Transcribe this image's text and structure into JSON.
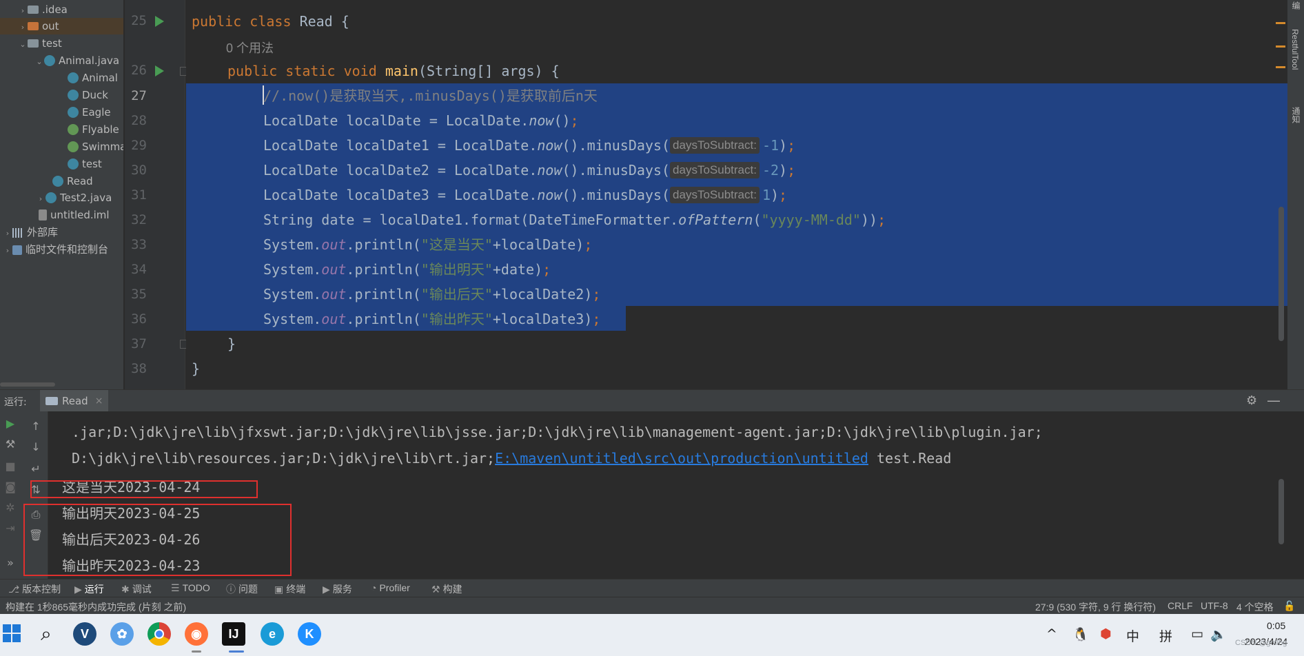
{
  "project_tree": [
    {
      "label": ".idea",
      "icon": "folder-icon",
      "arrow": "›"
    },
    {
      "label": "out",
      "icon": "folder-orange-icon",
      "arrow": "›"
    },
    {
      "label": "test",
      "icon": "folder-icon",
      "arrow": "⌄"
    },
    {
      "label": "Animal.java",
      "icon": "class-icon",
      "arrow": "⌄"
    },
    {
      "label": "Animal",
      "icon": "class-icon",
      "arrow": ""
    },
    {
      "label": "Duck",
      "icon": "class-icon",
      "arrow": ""
    },
    {
      "label": "Eagle",
      "icon": "class-icon",
      "arrow": ""
    },
    {
      "label": "Flyable",
      "icon": "interface-icon",
      "arrow": ""
    },
    {
      "label": "Swimmal",
      "icon": "interface-icon",
      "arrow": ""
    },
    {
      "label": "test",
      "icon": "class-icon",
      "arrow": ""
    },
    {
      "label": "Read",
      "icon": "class-icon",
      "arrow": ""
    },
    {
      "label": "Test2.java",
      "icon": "class-icon",
      "arrow": "›"
    },
    {
      "label": "untitled.iml",
      "icon": "file-icon",
      "arrow": ""
    },
    {
      "label": "外部库",
      "icon": "library-icon",
      "arrow": "›"
    },
    {
      "label": "临时文件和控制台",
      "icon": "scratch-icon",
      "arrow": "›"
    }
  ],
  "editor": {
    "line_numbers": [
      "25",
      "26",
      "27",
      "28",
      "29",
      "30",
      "31",
      "32",
      "33",
      "34",
      "35",
      "36",
      "37",
      "38"
    ],
    "usage_hint": "0 个用法",
    "line25": {
      "kw1": "public",
      "kw2": "class",
      "name": "Read",
      "brace": "{"
    },
    "line26": {
      "kw1": "public",
      "kw2": "static",
      "kw3": "void",
      "fn": "main",
      "params": "(String[] args) {"
    },
    "line27": {
      "comment": "//.now()是获取当天,.minusDays()是获取前后n天"
    },
    "line28": {
      "a": "LocalDate localDate = LocalDate.",
      "b": "now",
      "c": "()",
      "semi": ";"
    },
    "line29": {
      "a": "LocalDate localDate1 = LocalDate.",
      "b": "now",
      "c": "().minusDays(",
      "hint": "daysToSubtract:",
      "num": "-1",
      "d": ")",
      "semi": ";"
    },
    "line30": {
      "a": "LocalDate localDate2 = LocalDate.",
      "b": "now",
      "c": "().minusDays(",
      "hint": "daysToSubtract:",
      "num": "-2",
      "d": ")",
      "semi": ";"
    },
    "line31": {
      "a": "LocalDate localDate3 = LocalDate.",
      "b": "now",
      "c": "().minusDays(",
      "hint": "daysToSubtract:",
      "num": "1",
      "d": ")",
      "semi": ";"
    },
    "line32": {
      "a": "String date = localDate1.format(DateTimeFormatter.",
      "b": "ofPattern",
      "c": "(",
      "str": "\"yyyy-MM-dd\"",
      "d": "))",
      "semi": ";"
    },
    "line33": {
      "a": "System.",
      "field": "out",
      "b": ".println(",
      "str": "\"这是当天\"",
      "c": "+localDate)",
      "semi": ";"
    },
    "line34": {
      "a": "System.",
      "field": "out",
      "b": ".println(",
      "str": "\"输出明天\"",
      "c": "+date)",
      "semi": ";"
    },
    "line35": {
      "a": "System.",
      "field": "out",
      "b": ".println(",
      "str": "\"输出后天\"",
      "c": "+localDate2)",
      "semi": ";"
    },
    "line36": {
      "a": "System.",
      "field": "out",
      "b": ".println(",
      "str": "\"输出昨天\"",
      "c": "+localDate3)",
      "semi": ";"
    },
    "line37": "}",
    "line38": "}"
  },
  "right_strip": {
    "restful": "RestfulTool",
    "notify": "通知",
    "top": "编"
  },
  "run": {
    "label": "运行:",
    "tab": "Read",
    "tab_close": "×",
    "gear": "⚙",
    "minimize": "—",
    "console": {
      "line0": ".jar;D:\\jdk\\jre\\lib\\jfxswt.jar;D:\\jdk\\jre\\lib\\jsse.jar;D:\\jdk\\jre\\lib\\management-agent.jar;D:\\jdk\\jre\\lib\\plugin.jar;",
      "line1a": "D:\\jdk\\jre\\lib\\resources.jar;D:\\jdk\\jre\\lib\\rt.jar;",
      "line1link": "E:\\maven\\untitled\\src\\out\\production\\untitled",
      "line1b": " test.Read",
      "out1": "这是当天2023-04-24",
      "out2": "输出明天2023-04-25",
      "out3": "输出后天2023-04-26",
      "out4": "输出昨天2023-04-23"
    }
  },
  "toolwindows": [
    {
      "icon": "⎇",
      "label": "版本控制"
    },
    {
      "icon": "▶",
      "label": "运行"
    },
    {
      "icon": "✱",
      "label": "调试"
    },
    {
      "icon": "☰",
      "label": "TODO"
    },
    {
      "icon": "ⓘ",
      "label": "问题"
    },
    {
      "icon": "▣",
      "label": "终端"
    },
    {
      "icon": "▶",
      "label": "服务"
    },
    {
      "icon": "◔",
      "label": "Profiler"
    },
    {
      "icon": "⚒",
      "label": "构建"
    }
  ],
  "status": {
    "message": "构建在 1秒865毫秒内成功完成 (片刻 之前)",
    "position": "27:9 (530 字符, 9 行 换行符)",
    "line_sep": "CRLF",
    "encoding": "UTF-8",
    "indent": "4 个空格"
  },
  "taskbar": {
    "apps": [
      "search-icon",
      "vmware-icon",
      "photos-icon",
      "chrome-icon",
      "firefox-icon",
      "intellij-icon",
      "edge-icon",
      "kugou-icon"
    ],
    "tray": {
      "chevron": "^",
      "lang1": "中",
      "lang2": "拼"
    },
    "time": "0:05",
    "date": "2023/4/24",
    "watermark": "CSDN @gmlhg"
  },
  "colors": {
    "accent": "#214283",
    "redbox": "#e0302e",
    "run_green": "#499c54"
  }
}
